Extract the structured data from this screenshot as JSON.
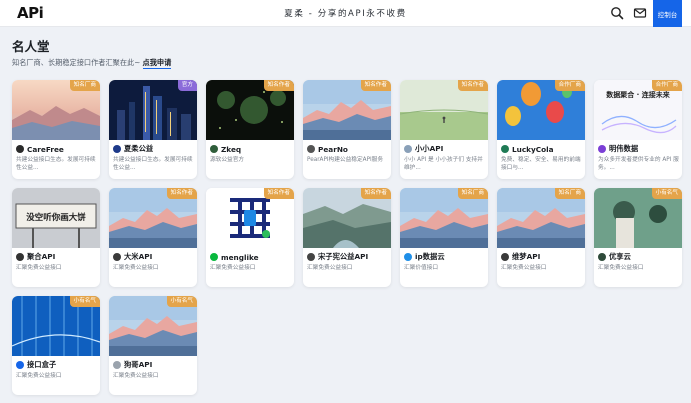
{
  "nav": {
    "logo": "APi",
    "tagline": "夏柔 - 分享的API永不收费",
    "console_label": "控制台"
  },
  "header": {
    "title": "名人堂",
    "desc": "知名厂商、长期稳定接口作者汇聚在此~",
    "apply_link": "点我申请"
  },
  "cards": [
    {
      "name": "CareFree",
      "desc": "共建公益接口生态。发展可持续性公益...",
      "badge": "知名厂商",
      "badge_kind": "vendor",
      "thumb": "sunset",
      "avatar": "#2b2b2b"
    },
    {
      "name": "夏柔公益",
      "desc": "共建公益接口生态。发展可持续性公益...",
      "badge": "官方",
      "badge_kind": "official",
      "thumb": "city",
      "avatar": "#1e3a8a"
    },
    {
      "name": "Zkeq",
      "desc": "源软公益官方",
      "badge": "知名作者",
      "badge_kind": "vendor",
      "thumb": "dark",
      "avatar": "#2f5d3a"
    },
    {
      "name": "PearNo",
      "desc": "PearAPI构建公益稳定API服务",
      "badge": "知名作者",
      "badge_kind": "vendor",
      "thumb": "mountain",
      "avatar": "#555555"
    },
    {
      "name": "小小API",
      "desc": "小小 API 是 小小孩子们 支持并维护...",
      "badge": "知名作者",
      "badge_kind": "vendor",
      "thumb": "grass",
      "avatar": "#8aa0b8"
    },
    {
      "name": "LuckyCola",
      "desc": "免费、稳定、安全、易用的前端接口与...",
      "badge": "合作厂商",
      "badge_kind": "vendor",
      "thumb": "balloons",
      "avatar": "#1f7a55"
    },
    {
      "name": "明伟数据",
      "desc": "为众多开发者提供专业的 API 服务。...",
      "badge": "合作厂商",
      "badge_kind": "vendor",
      "thumb": "datafusion",
      "thumb_text": "数据聚合 · 连接未来",
      "avatar": "#7b3fd6"
    },
    {
      "name": "聚合API",
      "desc": "汇聚免费公益接口",
      "badge": "",
      "badge_kind": "none",
      "thumb": "billboard",
      "thumb_text": "没空听你画大饼",
      "avatar": "#333333"
    },
    {
      "name": "大米API",
      "desc": "汇聚免费公益接口",
      "badge": "知名作者",
      "badge_kind": "vendor",
      "thumb": "mountain",
      "avatar": "#3b3b3b"
    },
    {
      "name": "menglike",
      "desc": "汇聚免费公益接口",
      "badge": "知名作者",
      "badge_kind": "vendor",
      "thumb": "qrcode",
      "avatar": "#09b83e"
    },
    {
      "name": "宋子宪公益API",
      "desc": "汇聚免费公益接口",
      "badge": "知名作者",
      "badge_kind": "vendor",
      "thumb": "valley",
      "avatar": "#444444"
    },
    {
      "name": "ip数据云",
      "desc": "汇聚价值接口",
      "badge": "知名厂商",
      "badge_kind": "vendor",
      "thumb": "mountain",
      "avatar": "#1f8fe8"
    },
    {
      "name": "维梦API",
      "desc": "汇聚免费公益接口",
      "badge": "知名厂商",
      "badge_kind": "vendor",
      "thumb": "mountain",
      "avatar": "#3a3a3a"
    },
    {
      "name": "优享云",
      "desc": "汇聚免费公益接口",
      "badge": "小有名气",
      "badge_kind": "vendor",
      "thumb": "anime",
      "avatar": "#2e4a3a"
    },
    {
      "name": "接口盒子",
      "desc": "汇聚免费公益接口",
      "badge": "小有名气",
      "badge_kind": "vendor",
      "thumb": "digital",
      "avatar": "#1565e8"
    },
    {
      "name": "狗哥API",
      "desc": "汇聚免费公益接口",
      "badge": "小有名气",
      "badge_kind": "vendor",
      "thumb": "mountain",
      "avatar": "#9aa3ad"
    }
  ]
}
